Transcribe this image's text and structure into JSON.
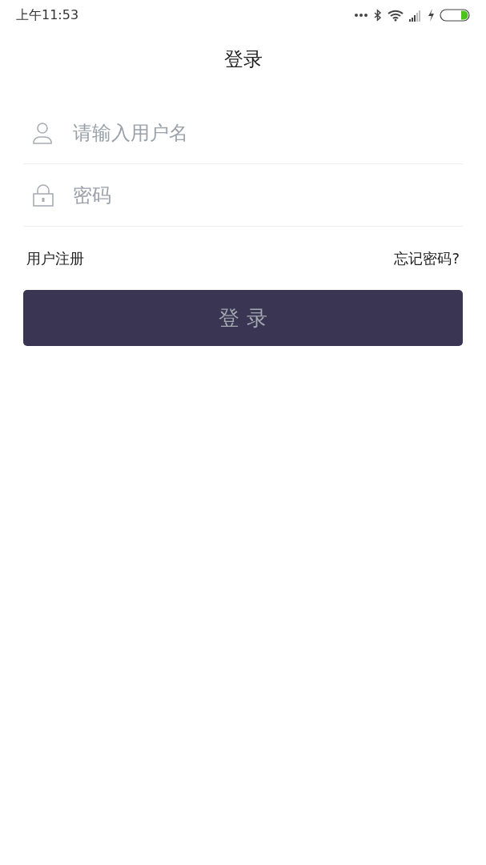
{
  "status_bar": {
    "time": "上午11:53"
  },
  "header": {
    "title": "登录"
  },
  "form": {
    "fields": [
      {
        "kind": "user",
        "placeholder": "请输入用户名"
      },
      {
        "kind": "lock",
        "placeholder": "密码"
      }
    ],
    "register_link": "用户注册",
    "forgot_link": "忘记密码?",
    "submit": "登 录"
  }
}
